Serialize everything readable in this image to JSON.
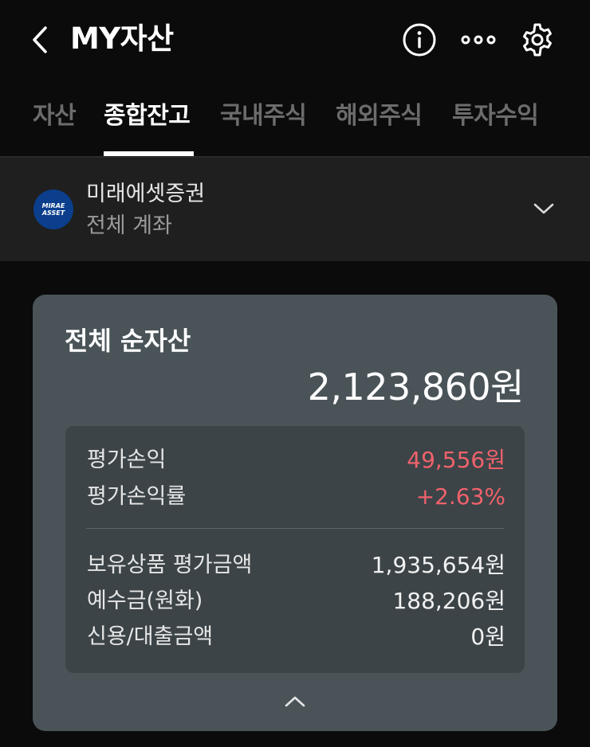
{
  "header": {
    "title": "MY자산",
    "icons": [
      "chevron-left-icon",
      "info-icon",
      "more-icon",
      "gear-icon"
    ]
  },
  "tabs": [
    {
      "label": "자산",
      "active": false
    },
    {
      "label": "종합잔고",
      "active": true
    },
    {
      "label": "국내주식",
      "active": false
    },
    {
      "label": "해외주식",
      "active": false
    },
    {
      "label": "투자수익",
      "active": false
    }
  ],
  "account": {
    "logo_line1": "MIRAE",
    "logo_line2": "ASSET",
    "broker": "미래에셋증권",
    "account": "전체 계좌"
  },
  "summary": {
    "title": "전체 순자산",
    "total": "2,123,860원",
    "rows": [
      {
        "label": "평가손익",
        "value": "49,556원"
      },
      {
        "label": "평가손익률",
        "value": "+2.63%"
      },
      {
        "label": "보유상품 평가금액",
        "value": "1,935,654원"
      },
      {
        "label": "예수금(원화)",
        "value": "188,206원"
      },
      {
        "label": "신용/대출금액",
        "value": "0원"
      }
    ]
  },
  "colors": {
    "background": "#0b0b0b",
    "card": "#4a5458",
    "inner_card": "#3c4448",
    "profit_red": "#f0626b",
    "tab_inactive": "#6c6c6c"
  }
}
